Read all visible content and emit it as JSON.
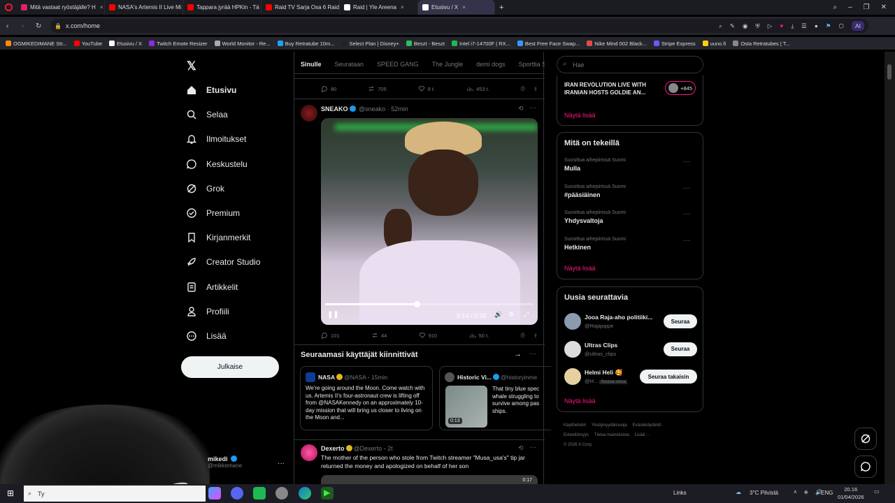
{
  "browser": {
    "tabs": [
      {
        "label": "Mitä vastaat ryöstäjälle? H",
        "color": "#e0245e",
        "active": false
      },
      {
        "label": "NASA's Artemis II Live Mi",
        "color": "#ff0000",
        "active": false
      },
      {
        "label": "Tappara jyrää HPKin - Tä",
        "color": "#ff0000",
        "active": false
      },
      {
        "label": "Raid TV Sarja Osa 6 Raidi",
        "color": "#ff0000",
        "active": false
      },
      {
        "label": "Raid | Yle Areena",
        "color": "#ffffff",
        "active": false
      },
      {
        "label": "Etusivu / X",
        "color": "#ffffff",
        "active": true
      }
    ],
    "url": "x.com/home",
    "bookmarks": [
      "OGMIKEDIMANE Str...",
      "YouTube",
      "Etusivu / X",
      "Twitch Emote Resizer",
      "World Monitor - Re...",
      "Buy Retratube 10m...",
      "Select Plan | Disney+",
      "Beszt - Beszt",
      "Intel i7-14700F | RX...",
      "Best Free Face Swap...",
      "Nike Mind 002 Black...",
      "Stripe Express",
      "uuno.fi",
      "Osta Retratubes | T..."
    ],
    "ai_label": "AI"
  },
  "nav": {
    "items": [
      {
        "label": "Etusivu",
        "icon": "home-icon"
      },
      {
        "label": "Selaa",
        "icon": "search-icon"
      },
      {
        "label": "Ilmoitukset",
        "icon": "bell-icon"
      },
      {
        "label": "Keskustelu",
        "icon": "chat-icon"
      },
      {
        "label": "Grok",
        "icon": "grok-icon"
      },
      {
        "label": "Premium",
        "icon": "premium-icon"
      },
      {
        "label": "Kirjanmerkit",
        "icon": "bookmark-icon"
      },
      {
        "label": "Creator Studio",
        "icon": "rocket-icon"
      },
      {
        "label": "Artikkelit",
        "icon": "article-icon"
      },
      {
        "label": "Profiili",
        "icon": "profile-icon"
      },
      {
        "label": "Lisää",
        "icon": "more-icon"
      }
    ],
    "post": "Julkaise",
    "account": {
      "name": "mikedi",
      "handle": "@mikkemane"
    }
  },
  "feed": {
    "tabs": [
      "Sinulle",
      "Seurataan",
      "SPEED GANG",
      "The Jungle",
      "demi dogs",
      "Sporttia S"
    ],
    "top_actions": {
      "replies": "80",
      "reposts": "705",
      "likes": "8 t.",
      "views": "453 t."
    },
    "tweet": {
      "name": "SNEAKO",
      "handle": "@sneako",
      "time": "52min",
      "video": {
        "current": "0:14",
        "duration": "0:32",
        "progress": 0.44
      },
      "actions": {
        "replies": "101",
        "reposts": "44",
        "likes": "910",
        "views": "50 t."
      }
    },
    "follow_section": {
      "title": "Seuraamasi käyttäjät kiinnittivät",
      "cards": [
        {
          "name": "NASA",
          "handle": "@NASA",
          "time": "15min",
          "text": "We're going around the Moon. Come watch with us. Artemis II's four-astronaut crew is lifting off from @NASAKennedy on an approximately 10-day mission that will bring us closer to living on the Moon and..."
        },
        {
          "name": "Historic Vi...",
          "handle": "@historyinme",
          "duration": "0:13",
          "text": "That tiny blue spec whale struggling to survive among pas ships."
        }
      ]
    },
    "next_tweet": {
      "name": "Dexerto",
      "handle": "@Dexerto",
      "time": "2t",
      "text": "The mother of the person who stole from Twitch streamer \"Musa_usa's\" tip jar returned the money and apologized on behalf of her son",
      "badge": "0:17"
    }
  },
  "right": {
    "search_placeholder": "Hae",
    "live": {
      "title": "IRAN REVOLUTION LIVE WITH IRANIAN HOSTS GOLDIE AN...",
      "count": "+845",
      "more": "Näytä lisää"
    },
    "trends": {
      "title": "Mitä on tekeillä",
      "items": [
        {
          "meta": "Suosittua aihepiirissä Suomi",
          "name": "Mulla"
        },
        {
          "meta": "Suosittua aihepiirissä Suomi",
          "name": "#pääsiäinen"
        },
        {
          "meta": "Suosittua aihepiirissä Suomi",
          "name": "Yhdysvaltoja"
        },
        {
          "meta": "Suosittua aihepiirissä Suomi",
          "name": "Hetkinen"
        }
      ],
      "more": "Näytä lisää"
    },
    "who": {
      "title": "Uusia seurattavia",
      "items": [
        {
          "name": "Jooa Raja-aho politiiki...",
          "handle": "@Rajajoppe",
          "button": "Seuraa",
          "note": ""
        },
        {
          "name": "Ultras Clips",
          "handle": "@ultras_clips",
          "button": "Seuraa",
          "note": ""
        },
        {
          "name": "Helmi Heli 🥰",
          "handle": "@H...",
          "button": "Seuraa takaisin",
          "note": "Seuraa sinua"
        }
      ],
      "more": "Näytä lisää"
    },
    "footer": [
      "Käyttöehdot",
      "Yksityisyydänsuoja",
      "Evästekäytäntö",
      "Esteettömyys",
      "Tietoa mainoksista",
      "Lisää ···",
      "© 2026 X Corp."
    ]
  },
  "taskbar": {
    "search": "Ty",
    "links": "Links",
    "weather": "3°C Pilvistä",
    "lang": "ENG",
    "time": "20.16",
    "date": "01/04/2026"
  }
}
